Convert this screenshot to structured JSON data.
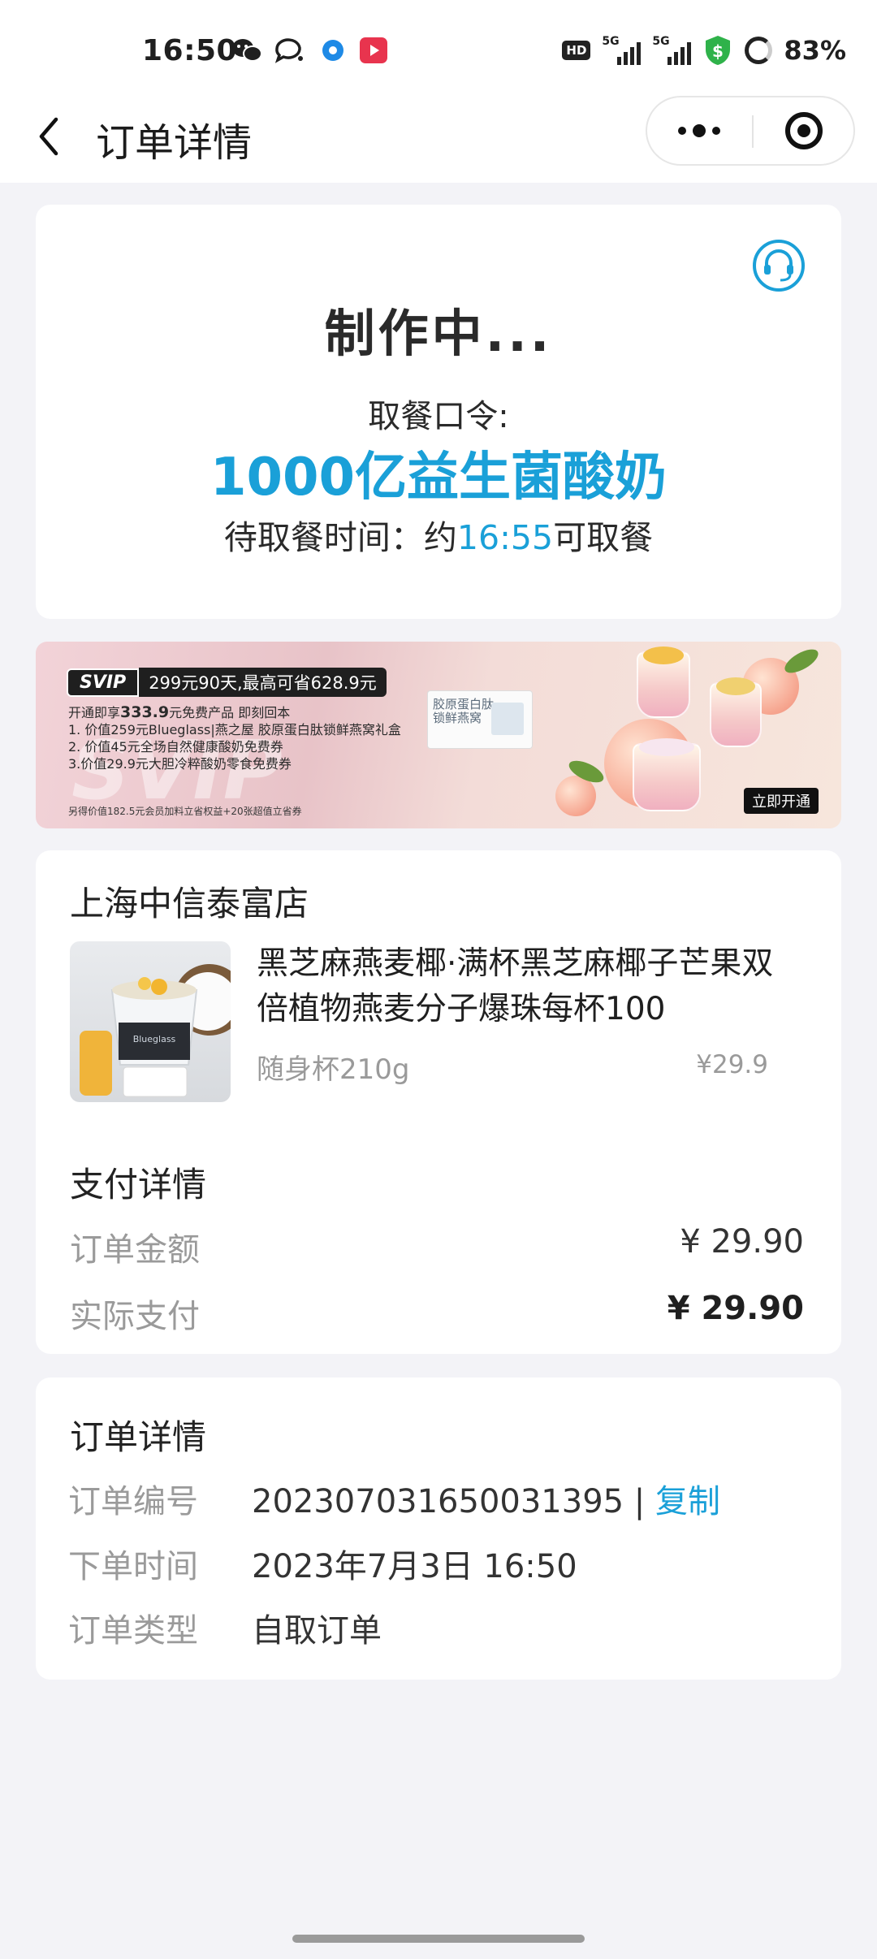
{
  "status_bar": {
    "time": "16:50",
    "battery": "83%",
    "network1": "5G",
    "network2": "5G",
    "hd": "HD",
    "icons": [
      "wechat-icon",
      "chat-bubble-icon",
      "blue-circle-app-icon",
      "play-app-icon",
      "signal-icon",
      "shield-icon",
      "battery-ring-icon"
    ]
  },
  "nav": {
    "title": "订单详情"
  },
  "status_card": {
    "title": "制作中...",
    "pickup_label": "取餐口令:",
    "pickup_code": "1000亿益生菌酸奶",
    "time_prefix": "待取餐时间：约",
    "time_value": "16:55",
    "time_suffix": "可取餐"
  },
  "banner": {
    "badge": "SVIP",
    "offer": "299元90天,最高可省628.9元",
    "line0_a": "开通即享",
    "line0_amount": "333.9",
    "line0_b": "元免费产品 即刻回本",
    "line1": "1. 价值259元Blueglass|燕之屋 胶原蛋白肽锁鲜燕窝礼盒",
    "line2": "2. 价值45元全场自然健康酸奶免费券",
    "line3": "3.价值29.9元大胆冷粹酸奶零食免费券",
    "footnote": "另得价值182.5元会员加料立省权益+20张超值立省券",
    "box_text": "胶原蛋白肽\n锁鲜燕窝",
    "watermark": "SVIP",
    "cta": "立即开通"
  },
  "product_card": {
    "store": "上海中信泰富店",
    "product_name": "黑芝麻燕麦椰·满杯黑芝麻椰子芒果双倍植物燕麦分子爆珠每杯100",
    "spec": "随身杯210g",
    "price": "¥29.9",
    "thumbnail_brand": "Blueglass",
    "payment_title": "支付详情",
    "order_amount_label": "订单金额",
    "order_amount": "¥ 29.90",
    "actual_paid_label": "实际支付",
    "actual_paid": "¥ 29.90"
  },
  "order_card": {
    "title": "订单详情",
    "no_label": "订单编号",
    "no_value": "202307031650031395",
    "separator": " | ",
    "copy_label": "复制",
    "time_label": "下单时间",
    "time_value": "2023年7月3日 16:50",
    "type_label": "订单类型",
    "type_value": "自取订单"
  },
  "colors": {
    "accent": "#1aa0d8",
    "background": "#f3f3f7",
    "card": "#ffffff"
  }
}
